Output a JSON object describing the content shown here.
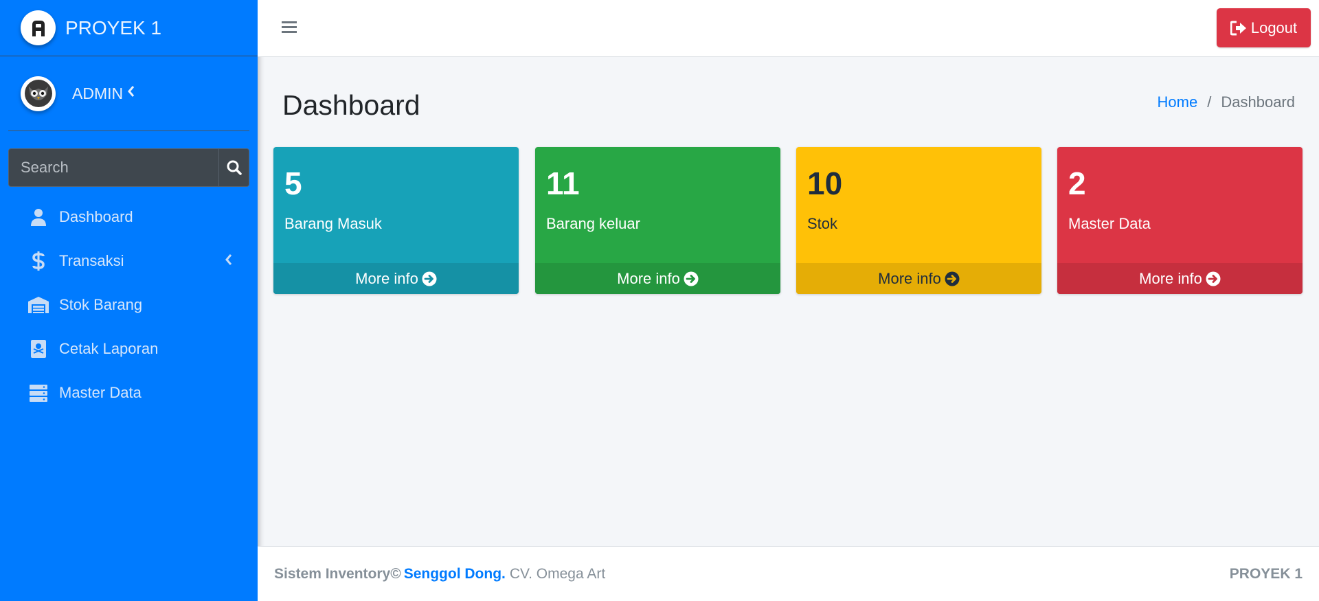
{
  "colors": {
    "sidebar": "#007bff",
    "info": "#17a2b8",
    "success": "#28a745",
    "warning": "#ffc107",
    "danger": "#dc3545"
  },
  "brand": {
    "title": "PROYEK 1",
    "logo_icon": "a-logo-icon"
  },
  "user": {
    "name": "ADMIN",
    "avatar_icon": "owl-avatar-icon"
  },
  "search": {
    "placeholder": "Search",
    "value": ""
  },
  "nav": {
    "items": [
      {
        "label": "Dashboard",
        "icon": "user-icon"
      },
      {
        "label": "Transaksi",
        "icon": "dollar-icon"
      },
      {
        "label": "Stok Barang",
        "icon": "warehouse-icon"
      },
      {
        "label": "Cetak Laporan",
        "icon": "report-book-icon"
      },
      {
        "label": "Master Data",
        "icon": "server-icon"
      }
    ]
  },
  "topbar": {
    "logout_label": "Logout"
  },
  "header": {
    "title": "Dashboard"
  },
  "breadcrumb": {
    "home": "Home",
    "separator": "/",
    "current": "Dashboard"
  },
  "boxes": [
    {
      "number": "5",
      "label": "Barang Masuk",
      "footer": "More info"
    },
    {
      "number": "11",
      "label": "Barang keluar",
      "footer": "More info"
    },
    {
      "number": "10",
      "label": "Stok",
      "footer": "More info"
    },
    {
      "number": "2",
      "label": "Master Data",
      "footer": "More info"
    }
  ],
  "footer": {
    "system": "Sistem Inventory©",
    "author": "Senggol Dong.",
    "company": "CV. Omega Art",
    "right": "PROYEK 1"
  }
}
